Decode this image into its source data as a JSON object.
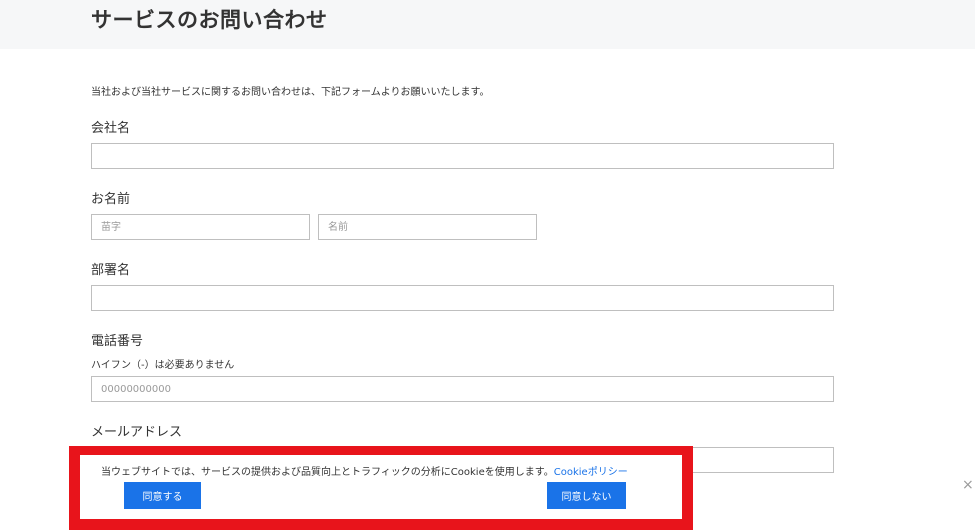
{
  "header": {
    "title": "サービスのお問い合わせ"
  },
  "intro": "当社および当社サービスに関するお問い合わせは、下記フォームよりお願いいたします。",
  "form": {
    "company": {
      "label": "会社名",
      "value": "",
      "placeholder": ""
    },
    "name": {
      "label": "お名前",
      "last_name": {
        "value": "",
        "placeholder": "苗字"
      },
      "first_name": {
        "value": "",
        "placeholder": "名前"
      }
    },
    "department": {
      "label": "部署名",
      "value": "",
      "placeholder": ""
    },
    "phone": {
      "label": "電話番号",
      "note": "ハイフン（-）は必要ありません",
      "value": "",
      "placeholder": "00000000000"
    },
    "email": {
      "label": "メールアドレス",
      "value": "",
      "placeholder": ""
    }
  },
  "cookie_banner": {
    "message": "当ウェブサイトでは、サービスの提供および品質向上とトラフィックの分析にCookieを使用します。",
    "policy_link": "Cookieポリシー",
    "agree_label": "同意する",
    "disagree_label": "同意しない",
    "close_icon": "×",
    "accent_color": "#1a73e8",
    "highlight_color": "#e8141b"
  }
}
